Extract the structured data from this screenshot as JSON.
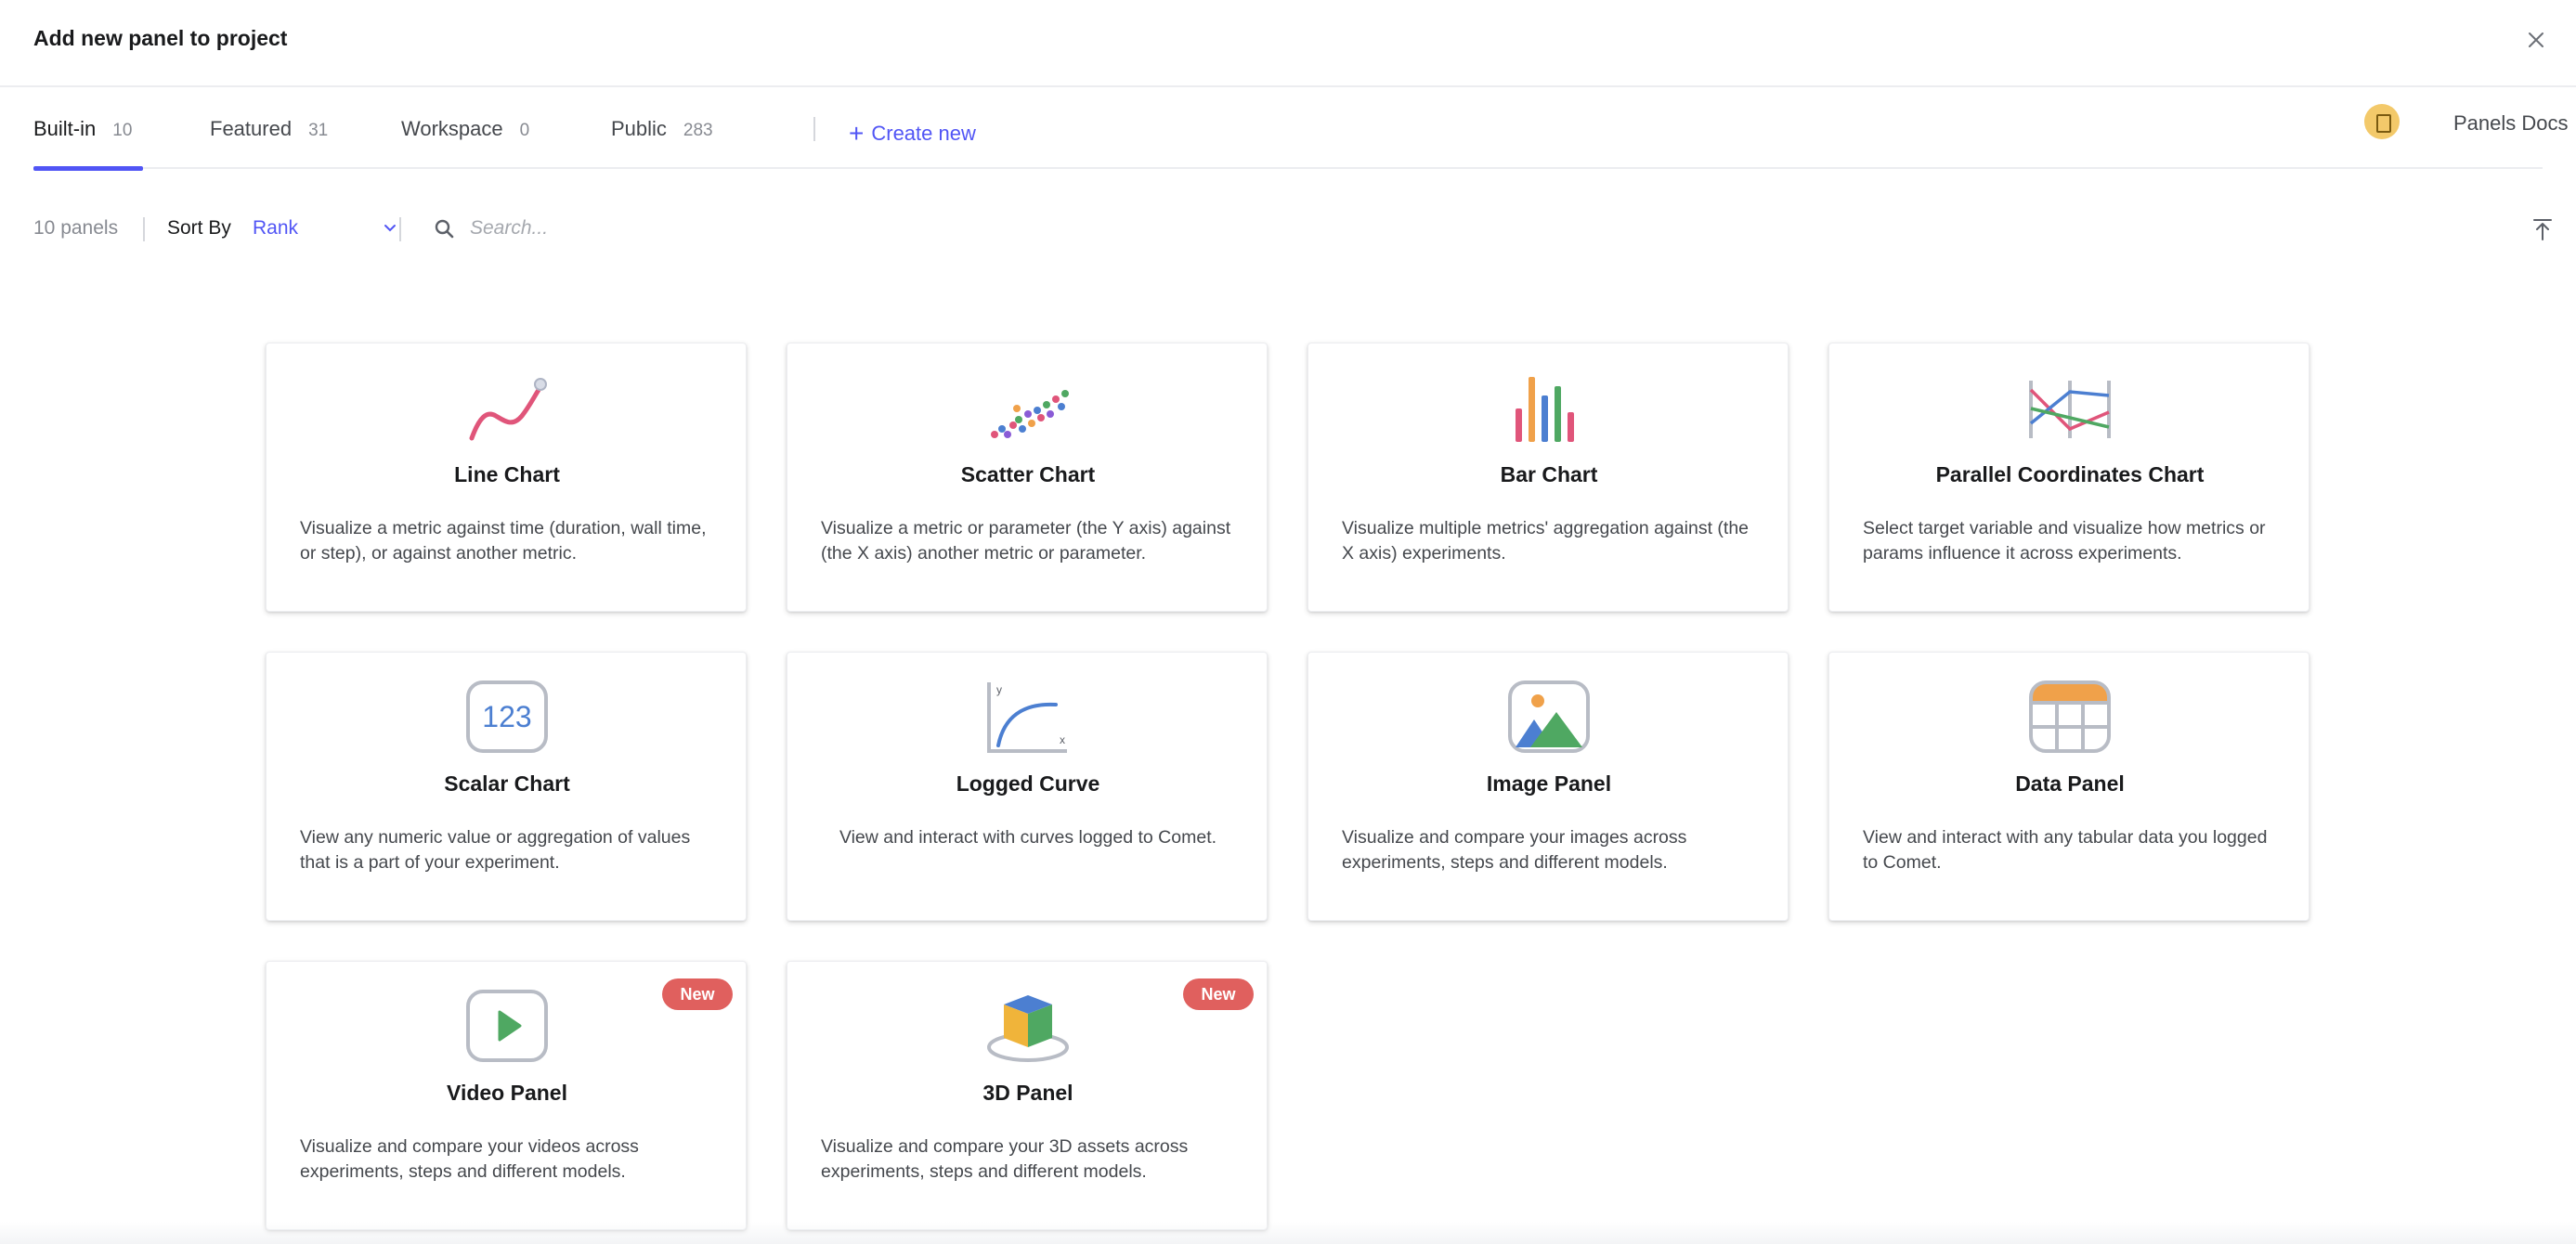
{
  "dialog": {
    "title": "Add new panel to project"
  },
  "tabs": [
    {
      "label": "Built-in",
      "count": "10"
    },
    {
      "label": "Featured",
      "count": "31"
    },
    {
      "label": "Workspace",
      "count": "0"
    },
    {
      "label": "Public",
      "count": "283"
    }
  ],
  "active_tab": "Built-in",
  "create_new": "Create new",
  "docs_link": "Panels Docs",
  "toolbar": {
    "count_label": "10 panels",
    "sort_label": "Sort By",
    "sort_value": "Rank",
    "search_placeholder": "Search..."
  },
  "panels": [
    {
      "name": "Line Chart",
      "icon": "line-chart-icon",
      "desc": "Visualize a metric against time (duration, wall time, or step), or against another metric.",
      "badge": ""
    },
    {
      "name": "Scatter Chart",
      "icon": "scatter-chart-icon",
      "desc": "Visualize a metric or parameter (the Y axis) against (the X axis) another metric or parameter.",
      "badge": ""
    },
    {
      "name": "Bar Chart",
      "icon": "bar-chart-icon",
      "desc": "Visualize multiple metrics' aggregation against (the X axis) experiments.",
      "badge": ""
    },
    {
      "name": "Parallel Coordinates Chart",
      "icon": "parallel-coordinates-icon",
      "desc": "Select target variable and visualize how metrics or params influence it across experiments.",
      "badge": ""
    },
    {
      "name": "Scalar Chart",
      "icon": "scalar-chart-icon",
      "icon_text": "123",
      "desc": "View any numeric value or aggregation of values that is a part of your experiment.",
      "badge": ""
    },
    {
      "name": "Logged Curve",
      "icon": "logged-curve-icon",
      "icon_axis_y": "y",
      "icon_axis_x": "x",
      "desc": "View and interact with curves logged to Comet.",
      "badge": ""
    },
    {
      "name": "Image Panel",
      "icon": "image-panel-icon",
      "desc": "Visualize and compare your images across experiments, steps and different models.",
      "badge": ""
    },
    {
      "name": "Data Panel",
      "icon": "data-panel-icon",
      "desc": "View and interact with any tabular data you logged to Comet.",
      "badge": ""
    },
    {
      "name": "Video Panel",
      "icon": "video-panel-icon",
      "desc": "Visualize and compare your videos across experiments, steps and different models.",
      "badge": "New"
    },
    {
      "name": "3D Panel",
      "icon": "3d-panel-icon",
      "desc": "Visualize and compare your 3D assets across experiments, steps and different models.",
      "badge": "New"
    }
  ],
  "colors": {
    "accent": "#5155F5",
    "badge": "#E0605E",
    "text_primary": "#191A1C",
    "text_secondary": "#45484D",
    "text_muted": "#878A91"
  }
}
